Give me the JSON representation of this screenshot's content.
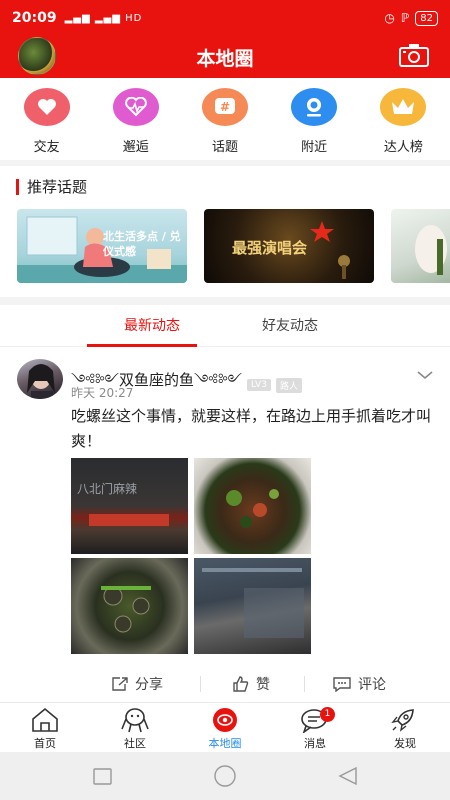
{
  "status_bar": {
    "time": "20:09",
    "signal": "▂▄▆ ▂▄▆ HD",
    "battery": "82"
  },
  "app_bar": {
    "title": "本地圈"
  },
  "quick_nav": [
    {
      "label": "交友",
      "icon": "heart-icon",
      "color": "#f0606a"
    },
    {
      "label": "邂逅",
      "icon": "pulse-icon",
      "color": "#e05bd0"
    },
    {
      "label": "话题",
      "icon": "hash-icon",
      "color": "#f58a56"
    },
    {
      "label": "附近",
      "icon": "location-icon",
      "color": "#2e8ef0"
    },
    {
      "label": "达人榜",
      "icon": "crown-icon",
      "color": "#f6b73a"
    }
  ],
  "recommended": {
    "title": "推荐话题",
    "cards": [
      {
        "text": "北生活多点 / 兑仪式感"
      },
      {
        "text": "最强演唱会"
      },
      {
        "text": ""
      }
    ]
  },
  "tabs": {
    "latest": "最新动态",
    "friends": "好友动态"
  },
  "post": {
    "author": "༺༻双鱼座的鱼༺༻",
    "level": "LV3",
    "role": "路人",
    "time": "昨天 20:27",
    "content": "吃螺丝这个事情，就要这样，在路边上用手抓着吃才叫爽！",
    "photo_sign": "八北门麻辣"
  },
  "actions": {
    "share": "分享",
    "like": "赞",
    "comment": "评论"
  },
  "bottom_nav": [
    {
      "label": "首页",
      "icon": "home-icon"
    },
    {
      "label": "社区",
      "icon": "community-icon"
    },
    {
      "label": "本地圈",
      "icon": "local-circle-icon",
      "active": true
    },
    {
      "label": "消息",
      "icon": "message-icon",
      "badge": "1"
    },
    {
      "label": "发现",
      "icon": "rocket-icon"
    }
  ],
  "colors": {
    "brand": "#e8130f",
    "active_label": "#2a8de6"
  }
}
